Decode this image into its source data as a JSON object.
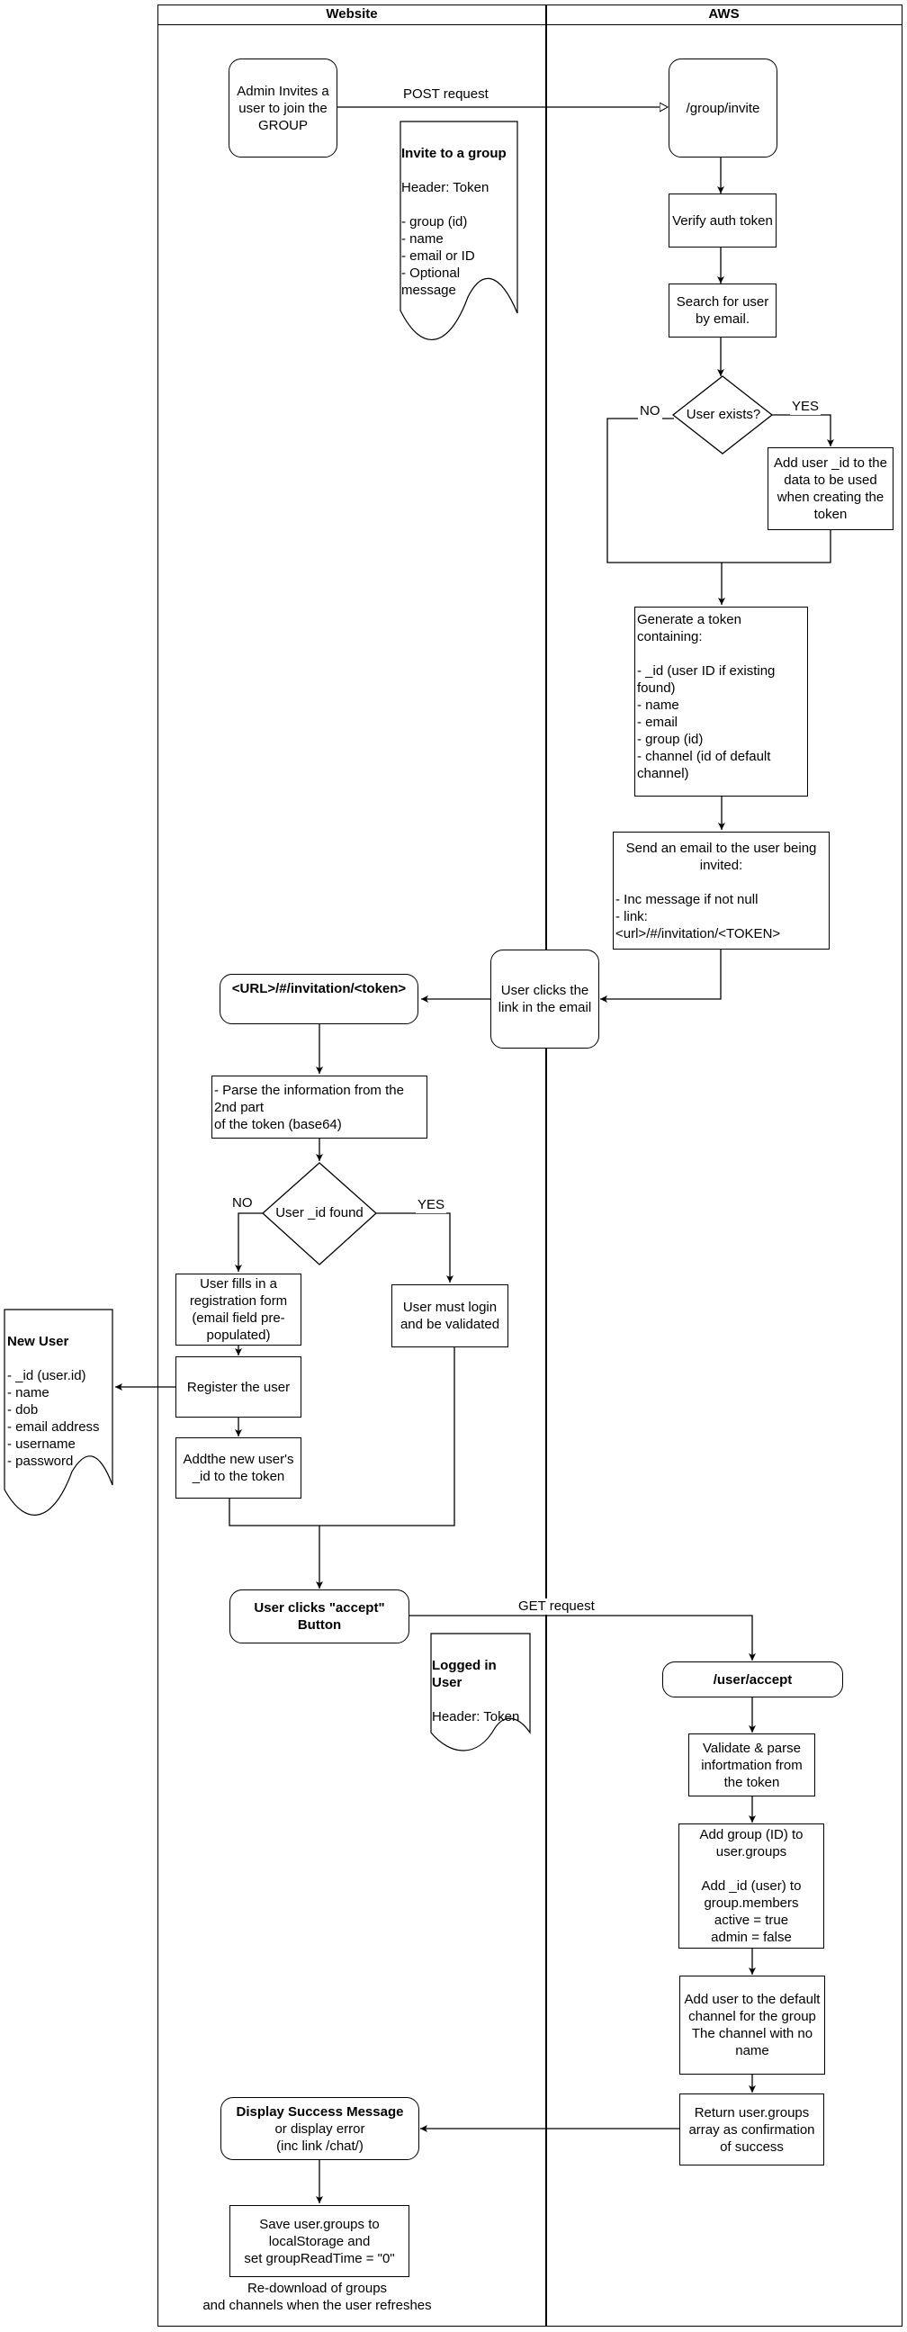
{
  "lanes": {
    "website": "Website",
    "aws": "AWS"
  },
  "website": {
    "admin_invites": "Admin Invites a user to join the GROUP",
    "invitation_url": "<URL>/#/invitation/<token>",
    "parse_token": "- Parse the information from the 2nd part\nof the token (base64)",
    "user_id_found": "User _id found",
    "no_label": "NO",
    "yes_label": "YES",
    "registration_form": "User fills in a registration form (email field pre-populated)",
    "register_user": "Register the user",
    "add_id_to_token": "Addthe new user's _id to the token",
    "must_login": "User must login and be validated",
    "accept_button": "User clicks \"accept\" Button",
    "display_success_title": "Display Success Message",
    "display_success_body": "or display error\n(inc link /chat/)",
    "save_groups": "Save user.groups to localStorage and\nset groupReadTime = \"0\"",
    "redownload_note": "Re-download of groups\nand channels when the user refreshes"
  },
  "aws": {
    "group_invite": "/group/invite",
    "verify_token": "Verify auth token",
    "search_user": "Search for user by email.",
    "user_exists": "User exists?",
    "no_label": "NO",
    "yes_label": "YES",
    "add_user_id": "Add user _id to the data to be used when creating the token",
    "generate_token": "Generate a token containing:\n\n - _id (user ID if existing found)\n - name\n - email\n - group (id)\n- channel (id of default channel)",
    "send_email_title": "Send an email to the user being invited:",
    "send_email_body": "\n - Inc message if not null\n - link:\n<url>/#/invitation/<TOKEN>",
    "user_clicks_link": "User clicks the link in the email",
    "user_accept": "/user/accept",
    "validate_parse": "Validate & parse infortmation from the  token",
    "add_group": "Add group (ID) to user.groups\n\nAdd _id (user) to group.members\nactive = true\nadmin = false",
    "add_default_channel": "Add user to the default channel for the group\nThe channel with no name",
    "return_groups": "Return user.groups array as confirmation of success"
  },
  "edges": {
    "post_request": "POST request",
    "get_request": "GET request"
  },
  "documents": {
    "invite_group": {
      "title": "Invite to a group",
      "body": "\nHeader: Token\n\n- group (id)\n- name\n- email or ID\n- Optional message"
    },
    "new_user": {
      "title": "New User",
      "body": "\n- _id (user.id)\n- name\n- dob\n- email address\n- username\n- password"
    },
    "logged_in_user": {
      "title": "Logged in User",
      "body": "\nHeader: Token"
    }
  }
}
